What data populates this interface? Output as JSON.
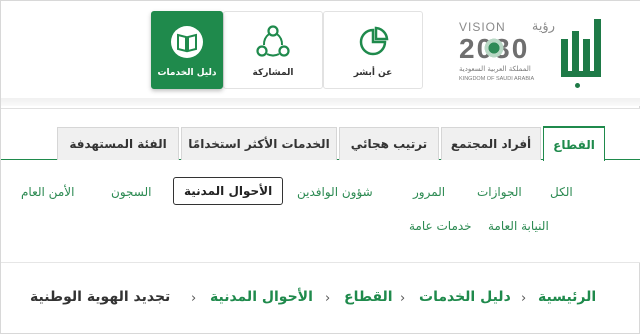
{
  "header": {
    "vision": {
      "word": "VISION",
      "word_ar": "رؤية",
      "year": "2030",
      "kingdom_ar": "المملكة العربية السعودية",
      "kingdom_en": "KINGDOM OF SAUDI ARABIA"
    },
    "tiles": [
      {
        "label": "عن أبشر",
        "icon": "pie-chart-icon"
      },
      {
        "label": "المشاركة",
        "icon": "share-nodes-icon"
      },
      {
        "label": "دليل الخدمات",
        "icon": "open-book-icon",
        "active": true
      }
    ]
  },
  "tabs": [
    {
      "label": "القطاع",
      "active": true
    },
    {
      "label": "أفراد المجتمع"
    },
    {
      "label": "ترتيب هجائي"
    },
    {
      "label": "الخدمات الأكثر استخدامًا"
    },
    {
      "label": "الفئة المستهدفة"
    }
  ],
  "filters": {
    "row1": [
      "الكل",
      "الجوازات",
      "المرور",
      "شؤون الوافدين",
      "الأحوال المدنية",
      "السجون",
      "الأمن العام"
    ],
    "row2": [
      "النيابة العامة",
      "خدمات عامة"
    ],
    "selected": "الأحوال المدنية"
  },
  "breadcrumb": {
    "items": [
      "الرئيسية",
      "دليل الخدمات",
      "القطاع",
      "الأحوال المدنية",
      "تجديد الهوية الوطنية"
    ],
    "separator": "‹"
  },
  "colors": {
    "brand_green": "#1f8a4c",
    "tab_bg": "#f0f0f0",
    "text": "#333333"
  }
}
